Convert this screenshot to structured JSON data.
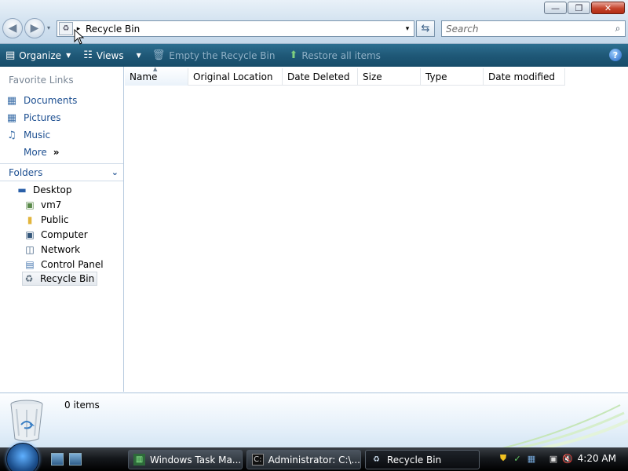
{
  "window": {
    "minimize_glyph": "—",
    "maximize_glyph": "❐",
    "close_glyph": "✕"
  },
  "address_bar": {
    "back_glyph": "◀",
    "forward_glyph": "▶",
    "history_drop_glyph": "▾",
    "path": "Recycle Bin",
    "breadcrumb_arrow": "▸",
    "drop_glyph": "▾",
    "refresh_glyph": "⇆",
    "search_placeholder": "Search",
    "search_glyph": "⌕"
  },
  "toolbar": {
    "organize": "Organize",
    "views": "Views",
    "empty_bin": "Empty the Recycle Bin",
    "restore_all": "Restore all items",
    "help": "?"
  },
  "nav": {
    "favorite_links_title": "Favorite Links",
    "favorites": [
      {
        "label": "Documents",
        "icon": "documents-icon"
      },
      {
        "label": "Pictures",
        "icon": "pictures-icon"
      },
      {
        "label": "Music",
        "icon": "music-icon"
      },
      {
        "label": "More",
        "icon": "more-chevron"
      }
    ],
    "more_glyph": "»",
    "folders_title": "Folders",
    "folders_chevron": "⌄",
    "tree": [
      {
        "label": "Desktop",
        "icon": "desktop-icon"
      },
      {
        "label": "vm7",
        "icon": "user-folder-icon"
      },
      {
        "label": "Public",
        "icon": "folder-icon"
      },
      {
        "label": "Computer",
        "icon": "computer-icon"
      },
      {
        "label": "Network",
        "icon": "network-icon"
      },
      {
        "label": "Control Panel",
        "icon": "control-panel-icon"
      },
      {
        "label": "Recycle Bin",
        "icon": "recycle-bin-icon",
        "selected": true
      }
    ]
  },
  "columns": [
    "Name",
    "Original Location",
    "Date Deleted",
    "Size",
    "Type",
    "Date modified"
  ],
  "sort_glyph": "▲",
  "details": {
    "item_count": "0 items"
  },
  "taskbar": {
    "tasks": [
      {
        "label": "Windows Task Ma...",
        "icon": "task-manager-icon"
      },
      {
        "label": "Administrator: C:\\...",
        "icon": "command-prompt-icon"
      },
      {
        "label": "Recycle Bin",
        "icon": "recycle-bin-icon",
        "active": true
      }
    ],
    "clock": "4:20 AM"
  },
  "colors": {
    "toolbar": "#1f5877",
    "link": "#1d4f91",
    "close_button": "#c4432b"
  }
}
